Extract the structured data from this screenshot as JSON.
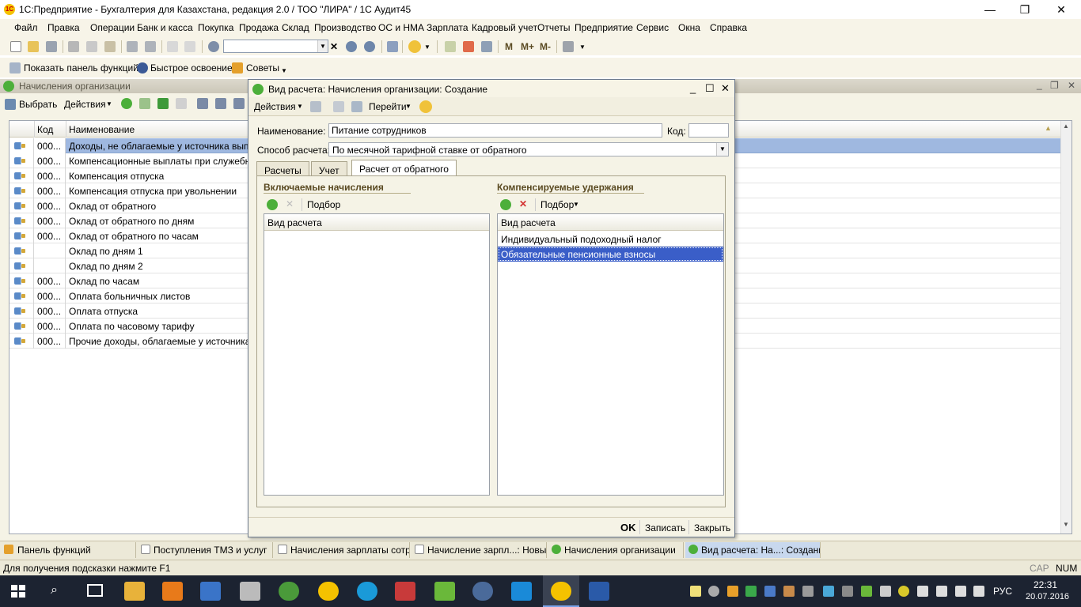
{
  "window": {
    "title": "1С:Предприятие - Бухгалтерия для Казахстана, редакция 2.0 / ТОО \"ЛИРА\" / 1С Аудит45",
    "min": "—",
    "max": "❐",
    "close": "✕",
    "logo": "1С"
  },
  "menu": [
    "Файл",
    "Правка",
    "Операции",
    "Банк и касса",
    "Покупка",
    "Продажа",
    "Склад",
    "Производство",
    "ОС и НМА",
    "Зарплата",
    "Кадровый учет",
    "Отчеты",
    "Предприятие",
    "Сервис",
    "Окна",
    "Справка"
  ],
  "toolbar2": {
    "m": "M",
    "mplus": "M+",
    "mminus": "M-"
  },
  "toolbar3": {
    "panel": "Показать панель функций",
    "quick": "Быстрое освоение",
    "tips": "Советы"
  },
  "list_window": {
    "title": "Начисления организации",
    "select": "Выбрать",
    "actions": "Действия",
    "col_code": "Код",
    "col_name": "Наименование",
    "rows": [
      {
        "code": "000...",
        "name": "Доходы, не облагаемые у источника выплат"
      },
      {
        "code": "000...",
        "name": "Компенсационные выплаты при служебных"
      },
      {
        "code": "000...",
        "name": "Компенсация отпуска"
      },
      {
        "code": "000...",
        "name": "Компенсация отпуска при увольнении"
      },
      {
        "code": "000...",
        "name": "Оклад от обратного"
      },
      {
        "code": "000...",
        "name": "Оклад от обратного по дням"
      },
      {
        "code": "000...",
        "name": "Оклад от обратного по часам"
      },
      {
        "code": "",
        "name": "Оклад по дням 1"
      },
      {
        "code": "",
        "name": "Оклад по дням 2"
      },
      {
        "code": "000...",
        "name": "Оклад по часам"
      },
      {
        "code": "000...",
        "name": "Оплата больничных листов"
      },
      {
        "code": "000...",
        "name": "Оплата отпуска"
      },
      {
        "code": "000...",
        "name": "Оплата по часовому тарифу"
      },
      {
        "code": "000...",
        "name": "Прочие доходы, облагаемые у источника"
      }
    ]
  },
  "dialog": {
    "title": "Вид расчета: Начисления организации: Создание",
    "actions": "Действия",
    "goto": "Перейти",
    "name_label": "Наименование:",
    "name_value": "Питание сотрудников",
    "code_label": "Код:",
    "code_value": "",
    "method_label": "Способ расчета:",
    "method_value": "По месячной тарифной ставке от обратного",
    "tabs": [
      "Расчеты",
      "Учет",
      "Расчет от обратного"
    ],
    "included_title": "Включаемые начисления",
    "compensated_title": "Компенсируемые удержания",
    "pick": "Подбор",
    "col": "Вид расчета",
    "compensated_rows": [
      "Индивидуальный подоходный налог",
      "Обязательные пенсионные взносы"
    ],
    "ok": "OK",
    "save": "Записать",
    "close": "Закрыть"
  },
  "taskbar_tabs": [
    "Панель функций",
    "Поступления ТМЗ и услуг",
    "Начисления зарплаты сотр...",
    "Начисление зарпл...: Новый *",
    "Начисления организации",
    "Вид расчета: На...: Создание"
  ],
  "status": {
    "hint": "Для получения подсказки нажмите F1",
    "cap": "CAP",
    "num": "NUM"
  },
  "tray": {
    "lang": "РУС",
    "time": "22:31",
    "date": "20.07.2016"
  },
  "colors": {
    "selection": "#3a5ec8",
    "accent_green": "#4caf3a",
    "row_highlight": "#9fb8e0"
  }
}
